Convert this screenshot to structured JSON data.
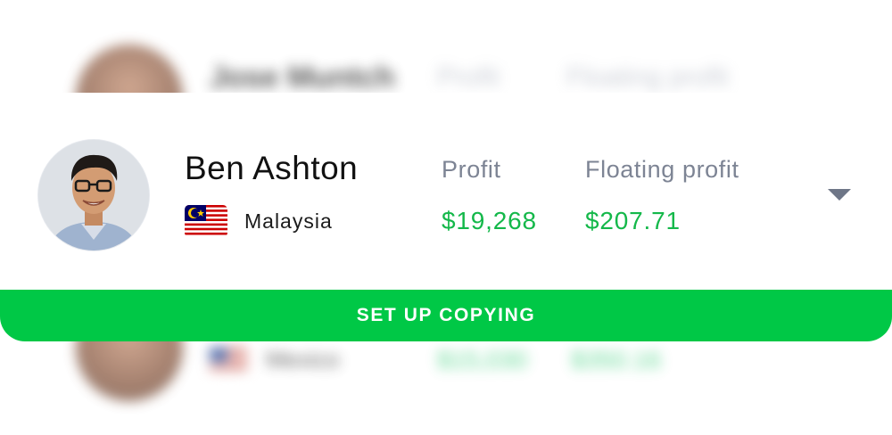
{
  "background_rows": {
    "top": {
      "name": "Jose Muntch",
      "col1": "Profit",
      "col2": "Floating profit"
    },
    "bottom": {
      "country": "Mexico",
      "val1": "$15,030",
      "val2": "$350.16"
    }
  },
  "trader": {
    "name": "Ben Ashton",
    "country": "Malaysia",
    "flag_icon": "malaysia-flag-icon",
    "avatar_icon": "trader-avatar"
  },
  "stats": {
    "profit_label": "Profit",
    "profit_value": "$19,268",
    "floating_label": "Floating profit",
    "floating_value": "$207.71"
  },
  "expand_icon": "chevron-down-icon",
  "cta": {
    "label": "SET UP COPYING"
  },
  "colors": {
    "accent_green": "#00c846",
    "value_green": "#14b84a",
    "label_gray": "#7d8494",
    "text_dark": "#111111"
  }
}
